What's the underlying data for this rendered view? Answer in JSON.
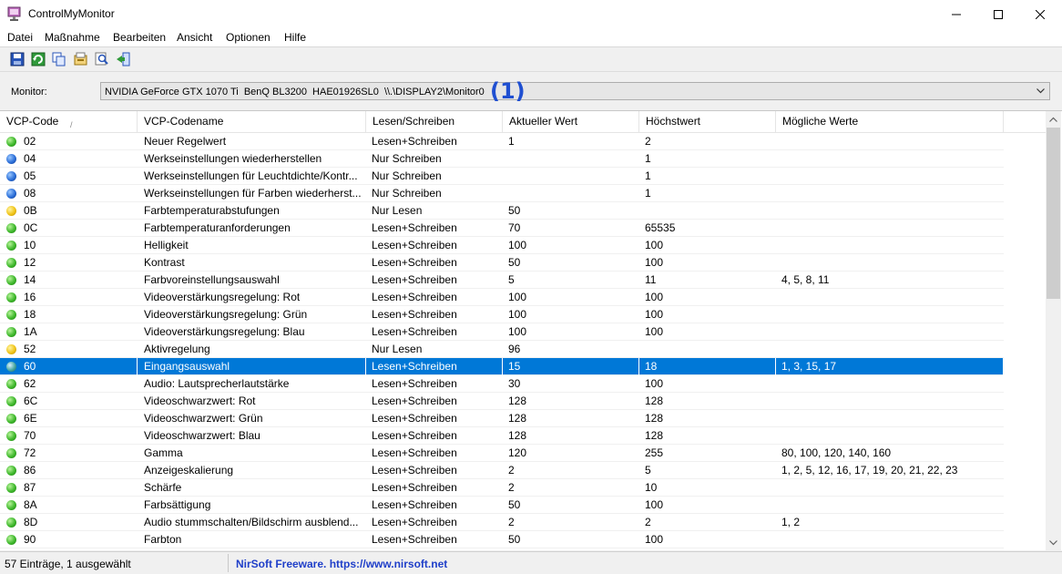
{
  "window": {
    "title": "ControlMyMonitor"
  },
  "menu": [
    "Datei",
    "Maßnahme",
    "Bearbeiten",
    "Ansicht",
    "Optionen",
    "Hilfe"
  ],
  "toolbar": [
    "save-icon",
    "refresh-icon",
    "copy-icon",
    "properties-icon",
    "find-icon",
    "exit-icon"
  ],
  "monitor": {
    "label": "Monitor:",
    "value": "NVIDIA GeForce GTX 1070 Ti  BenQ BL3200  HAE01926SL0  \\\\.\\DISPLAY2\\Monitor0",
    "annotation": "(1)"
  },
  "columns": [
    "VCP-Code",
    "VCP-Codename",
    "Lesen/Schreiben",
    "Aktueller Wert",
    "Höchstwert",
    "Mögliche Werte"
  ],
  "rows": [
    {
      "status": "green",
      "code": "02",
      "name": "Neuer Regelwert",
      "rw": "Lesen+Schreiben",
      "current": "1",
      "max": "2",
      "possible": ""
    },
    {
      "status": "blue",
      "code": "04",
      "name": "Werkseinstellungen wiederherstellen",
      "rw": "Nur Schreiben",
      "current": "",
      "max": "1",
      "possible": ""
    },
    {
      "status": "blue",
      "code": "05",
      "name": "Werkseinstellungen für Leuchtdichte/Kontr...",
      "rw": "Nur Schreiben",
      "current": "",
      "max": "1",
      "possible": ""
    },
    {
      "status": "blue",
      "code": "08",
      "name": "Werkseinstellungen für Farben wiederherst...",
      "rw": "Nur Schreiben",
      "current": "",
      "max": "1",
      "possible": ""
    },
    {
      "status": "yellow",
      "code": "0B",
      "name": "Farbtemperaturabstufungen",
      "rw": "Nur Lesen",
      "current": "50",
      "max": "",
      "possible": ""
    },
    {
      "status": "green",
      "code": "0C",
      "name": "Farbtemperaturanforderungen",
      "rw": "Lesen+Schreiben",
      "current": "70",
      "max": "65535",
      "possible": ""
    },
    {
      "status": "green",
      "code": "10",
      "name": "Helligkeit",
      "rw": "Lesen+Schreiben",
      "current": "100",
      "max": "100",
      "possible": ""
    },
    {
      "status": "green",
      "code": "12",
      "name": "Kontrast",
      "rw": "Lesen+Schreiben",
      "current": "50",
      "max": "100",
      "possible": ""
    },
    {
      "status": "green",
      "code": "14",
      "name": "Farbvoreinstellungsauswahl",
      "rw": "Lesen+Schreiben",
      "current": "5",
      "max": "11",
      "possible": "4, 5, 8, 11"
    },
    {
      "status": "green",
      "code": "16",
      "name": "Videoverstärkungsregelung: Rot",
      "rw": "Lesen+Schreiben",
      "current": "100",
      "max": "100",
      "possible": ""
    },
    {
      "status": "green",
      "code": "18",
      "name": "Videoverstärkungsregelung: Grün",
      "rw": "Lesen+Schreiben",
      "current": "100",
      "max": "100",
      "possible": ""
    },
    {
      "status": "green",
      "code": "1A",
      "name": "Videoverstärkungsregelung: Blau",
      "rw": "Lesen+Schreiben",
      "current": "100",
      "max": "100",
      "possible": ""
    },
    {
      "status": "yellow",
      "code": "52",
      "name": "Aktivregelung",
      "rw": "Nur Lesen",
      "current": "96",
      "max": "",
      "possible": ""
    },
    {
      "status": "sel",
      "code": "60",
      "name": "Eingangsauswahl",
      "rw": "Lesen+Schreiben",
      "current": "15",
      "max": "18",
      "possible": "1, 3, 15, 17",
      "selected": true
    },
    {
      "status": "green",
      "code": "62",
      "name": "Audio: Lautsprecherlautstärke",
      "rw": "Lesen+Schreiben",
      "current": "30",
      "max": "100",
      "possible": ""
    },
    {
      "status": "green",
      "code": "6C",
      "name": "Videoschwarzwert: Rot",
      "rw": "Lesen+Schreiben",
      "current": "128",
      "max": "128",
      "possible": ""
    },
    {
      "status": "green",
      "code": "6E",
      "name": "Videoschwarzwert: Grün",
      "rw": "Lesen+Schreiben",
      "current": "128",
      "max": "128",
      "possible": ""
    },
    {
      "status": "green",
      "code": "70",
      "name": "Videoschwarzwert: Blau",
      "rw": "Lesen+Schreiben",
      "current": "128",
      "max": "128",
      "possible": ""
    },
    {
      "status": "green",
      "code": "72",
      "name": "Gamma",
      "rw": "Lesen+Schreiben",
      "current": "120",
      "max": "255",
      "possible": "80, 100, 120, 140, 160"
    },
    {
      "status": "green",
      "code": "86",
      "name": "Anzeigeskalierung",
      "rw": "Lesen+Schreiben",
      "current": "2",
      "max": "5",
      "possible": "1, 2, 5, 12, 16, 17, 19, 20, 21, 22, 23"
    },
    {
      "status": "green",
      "code": "87",
      "name": "Schärfe",
      "rw": "Lesen+Schreiben",
      "current": "2",
      "max": "10",
      "possible": ""
    },
    {
      "status": "green",
      "code": "8A",
      "name": "Farbsättigung",
      "rw": "Lesen+Schreiben",
      "current": "50",
      "max": "100",
      "possible": ""
    },
    {
      "status": "green",
      "code": "8D",
      "name": "Audio stummschalten/Bildschirm ausblend...",
      "rw": "Lesen+Schreiben",
      "current": "2",
      "max": "2",
      "possible": "1, 2"
    },
    {
      "status": "green",
      "code": "90",
      "name": "Farbton",
      "rw": "Lesen+Schreiben",
      "current": "50",
      "max": "100",
      "possible": ""
    }
  ],
  "status": {
    "count": "57 Einträge, 1 ausgewählt",
    "credit": "NirSoft Freeware. https://www.nirsoft.net"
  }
}
